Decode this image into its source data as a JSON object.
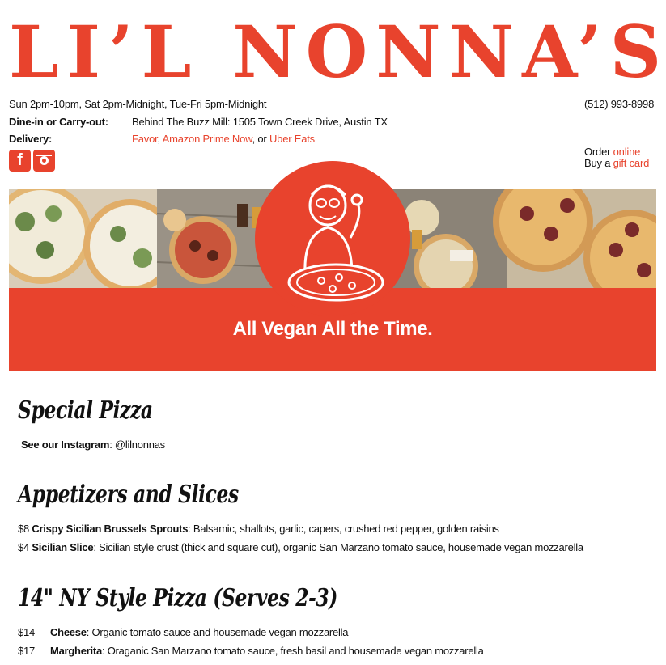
{
  "brand": {
    "logo_text": "LI’L NONNA’S",
    "accent": "#e8432d"
  },
  "header": {
    "hours": "Sun 2pm-10pm, Sat 2pm-Midnight, Tue-Fri 5pm-Midnight",
    "phone": "(512) 993-8998",
    "dinein_label": "Dine-in or Carry-out:",
    "dinein_value": "Behind The Buzz Mill: 1505 Town Creek Drive, Austin TX",
    "delivery_label": "Delivery:",
    "delivery_links": [
      "Favor",
      "Amazon Prime Now",
      "Uber Eats"
    ],
    "delivery_sep1": ", ",
    "delivery_sep2": ", or ",
    "order_prefix": "Order ",
    "order_link": "online",
    "gift_prefix": "Buy a ",
    "gift_link": "gift card"
  },
  "social": {
    "facebook_icon": "facebook-icon",
    "instagram_icon": "instagram-icon",
    "facebook_glyph": "f"
  },
  "hero": {
    "tagline": "All Vegan All the Time."
  },
  "sections": {
    "special": {
      "title": "Special Pizza",
      "see_label": "See our Instagram",
      "see_sep": ": ",
      "handle": "@lilnonnas"
    },
    "appetizers": {
      "title": "Appetizers and Slices",
      "items": [
        {
          "price": "$8",
          "name": "Crispy Sicilian Brussels Sprouts",
          "desc": ": Balsamic, shallots, garlic, capers, crushed red pepper, golden raisins"
        },
        {
          "price": "$4",
          "name": "Sicilian Slice",
          "desc": ": Sicilian style crust (thick and square cut), organic San Marzano tomato sauce, housemade vegan mozzarella"
        }
      ]
    },
    "ny": {
      "title": "14\" NY Style Pizza (Serves 2-3)",
      "items": [
        {
          "price": "$14",
          "name": "Cheese",
          "desc": ": Organic tomato sauce and housemade vegan mozzarella"
        },
        {
          "price": "$17",
          "name": "Margherita",
          "desc": ": Oraganic San Marzano tomato sauce, fresh basil and housemade vegan mozzarella"
        }
      ]
    }
  }
}
